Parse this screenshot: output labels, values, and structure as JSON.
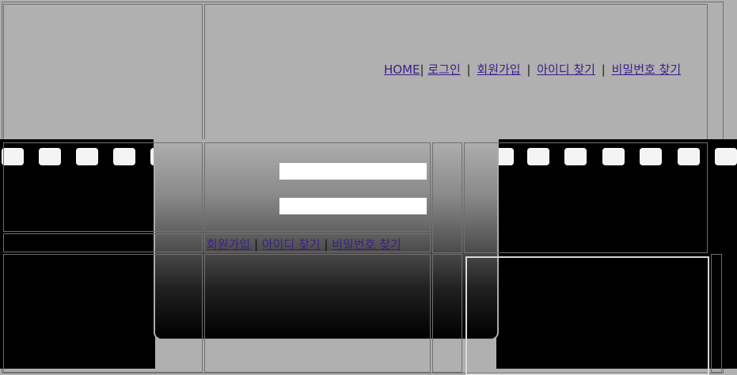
{
  "top_nav": {
    "home": "HOME",
    "sep_home": "|",
    "login": "로그인",
    "sep1": "|",
    "join": "회원가입",
    "sep2": "|",
    "find_id": "아이디 찾기",
    "sep3": "|",
    "find_pw": "비밀번호 찾기"
  },
  "login_box": {
    "join": "회원가입",
    "sep1": "|",
    "find_id": "아이디 찾기",
    "sep2": "|",
    "find_pw": "비밀번호 찾기"
  },
  "colors": {
    "background": "#b0b0b0",
    "film": "#000000",
    "link": "#3a1f8a"
  }
}
